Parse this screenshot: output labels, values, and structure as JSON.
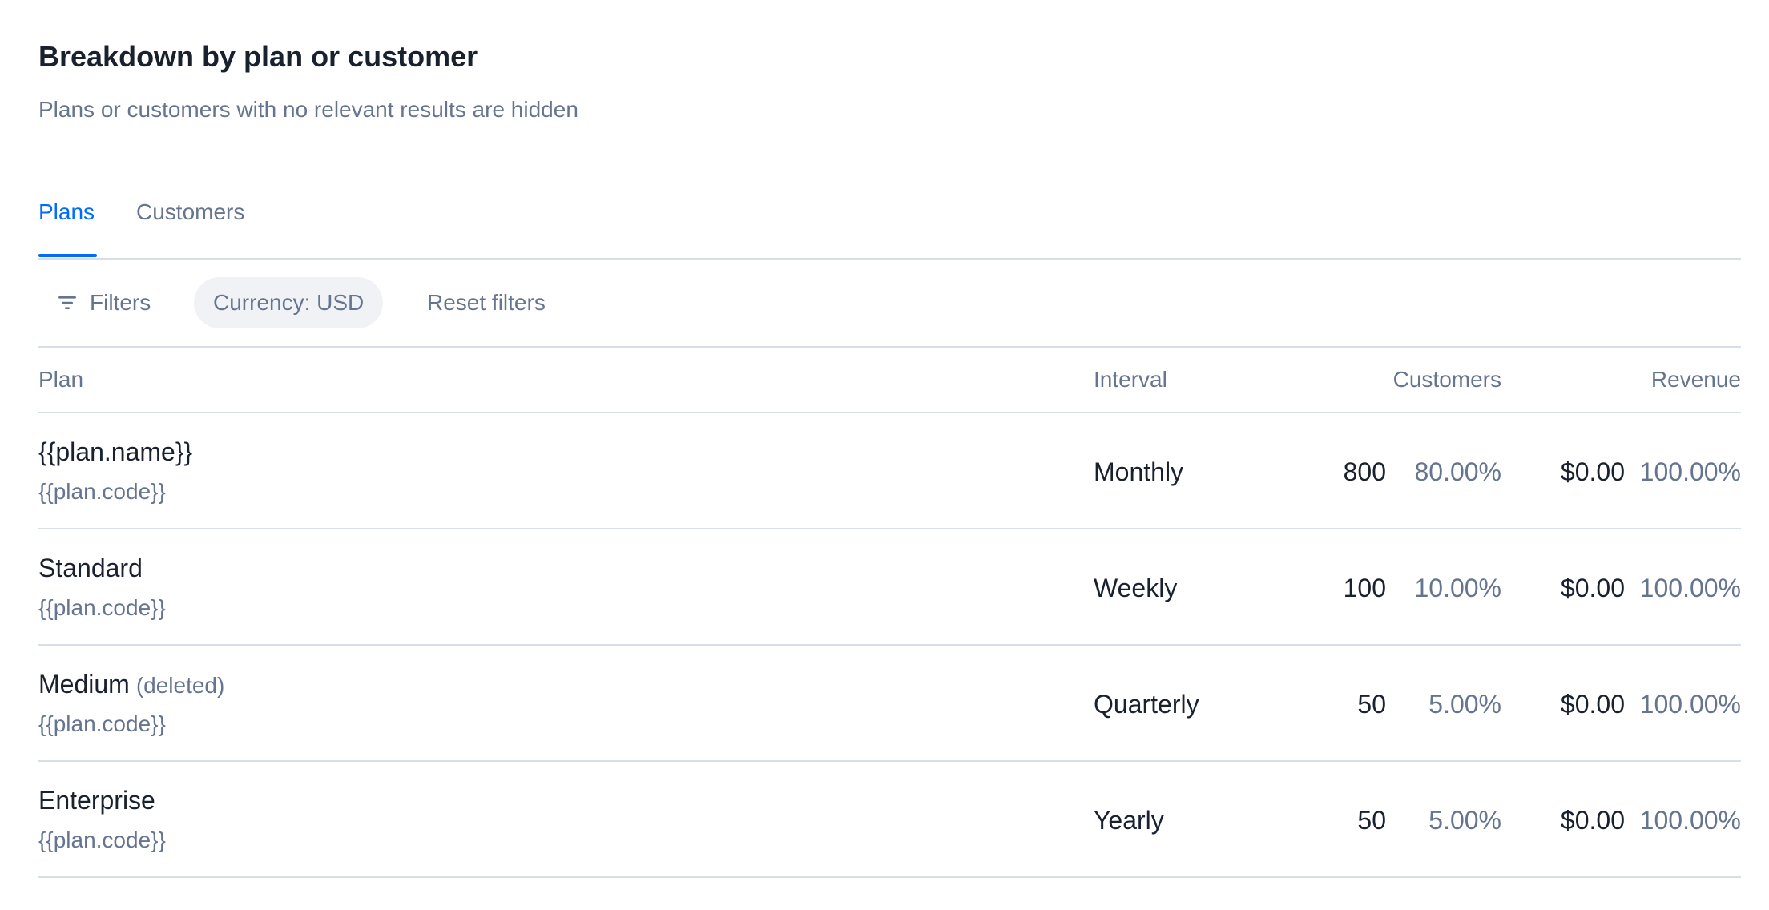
{
  "header": {
    "title": "Breakdown by plan or customer",
    "subtitle": "Plans or customers with no relevant results are hidden"
  },
  "tabs": [
    {
      "label": "Plans",
      "active": true
    },
    {
      "label": "Customers",
      "active": false
    }
  ],
  "filters": {
    "filters_label": "Filters",
    "filters_icon": "filter-lines-icon",
    "currency_chip": "Currency: USD",
    "reset_label": "Reset filters"
  },
  "table": {
    "columns": {
      "plan": "Plan",
      "interval": "Interval",
      "customers": "Customers",
      "revenue": "Revenue"
    },
    "rows": [
      {
        "name": "{{plan.name}}",
        "deleted": "",
        "code": "{{plan.code}}",
        "interval": "Monthly",
        "customers": "800",
        "customers_pct": "80.00%",
        "revenue": "$0.00",
        "revenue_pct": "100.00%"
      },
      {
        "name": "Standard",
        "deleted": "",
        "code": "{{plan.code}}",
        "interval": "Weekly",
        "customers": "100",
        "customers_pct": "10.00%",
        "revenue": "$0.00",
        "revenue_pct": "100.00%"
      },
      {
        "name": "Medium",
        "deleted": "(deleted)",
        "code": "{{plan.code}}",
        "interval": "Quarterly",
        "customers": "50",
        "customers_pct": "5.00%",
        "revenue": "$0.00",
        "revenue_pct": "100.00%"
      },
      {
        "name": "Enterprise",
        "deleted": "",
        "code": "{{plan.code}}",
        "interval": "Yearly",
        "customers": "50",
        "customers_pct": "5.00%",
        "revenue": "$0.00",
        "revenue_pct": "100.00%"
      }
    ]
  },
  "colors": {
    "primary": "#006cfa",
    "text": "#19212e",
    "muted": "#66758f",
    "border": "#d9dfe8",
    "chip_bg": "#f0f2f5"
  }
}
